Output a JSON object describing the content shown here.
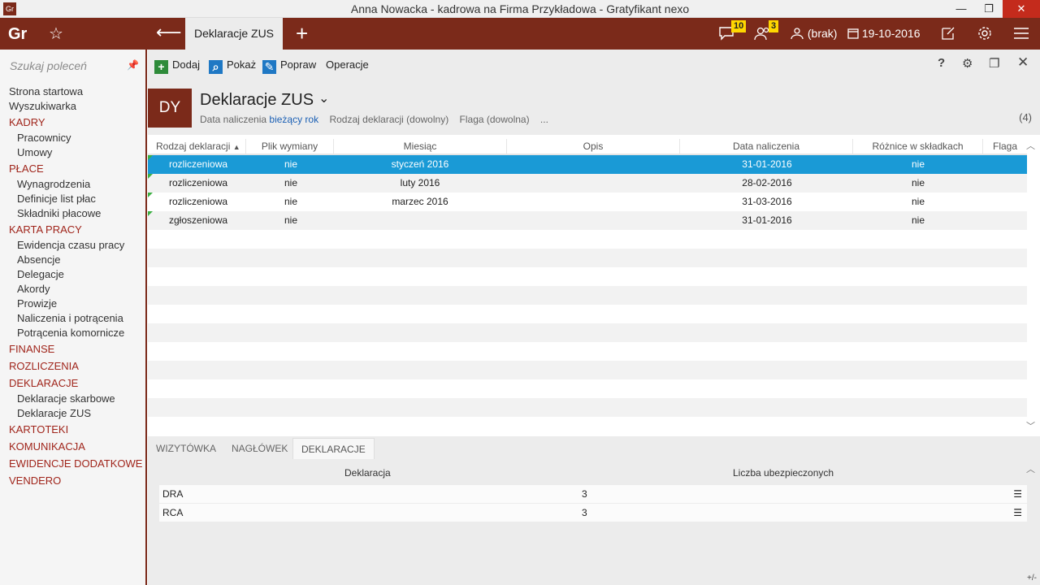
{
  "window": {
    "title": "Anna Nowacka - kadrowa na Firma Przykładowa - Gratyfikant nexo",
    "app_icon": "Gr",
    "minimize": "—",
    "restore": "❐",
    "close": "✕"
  },
  "topbar": {
    "logo": "Gr",
    "active_tab": "Deklaracje ZUS",
    "messages_badge": "10",
    "tasks_badge": "3",
    "user_label": "(brak)",
    "date": "19-10-2016"
  },
  "sidebar": {
    "search_placeholder": "Szukaj poleceń",
    "items": [
      {
        "label": "Strona startowa",
        "kind": "item"
      },
      {
        "label": "Wyszukiwarka",
        "kind": "item"
      },
      {
        "label": "KADRY",
        "kind": "cat"
      },
      {
        "label": "Pracownicy",
        "kind": "sub"
      },
      {
        "label": "Umowy",
        "kind": "sub"
      },
      {
        "label": "PŁACE",
        "kind": "cat"
      },
      {
        "label": "Wynagrodzenia",
        "kind": "sub"
      },
      {
        "label": "Definicje list płac",
        "kind": "sub"
      },
      {
        "label": "Składniki płacowe",
        "kind": "sub"
      },
      {
        "label": "KARTA PRACY",
        "kind": "cat"
      },
      {
        "label": "Ewidencja czasu pracy",
        "kind": "sub"
      },
      {
        "label": "Absencje",
        "kind": "sub"
      },
      {
        "label": "Delegacje",
        "kind": "sub"
      },
      {
        "label": "Akordy",
        "kind": "sub"
      },
      {
        "label": "Prowizje",
        "kind": "sub"
      },
      {
        "label": "Naliczenia i potrącenia",
        "kind": "sub"
      },
      {
        "label": "Potrącenia komornicze",
        "kind": "sub"
      },
      {
        "label": "FINANSE",
        "kind": "cat"
      },
      {
        "label": "ROZLICZENIA",
        "kind": "cat"
      },
      {
        "label": "DEKLARACJE",
        "kind": "cat"
      },
      {
        "label": "Deklaracje skarbowe",
        "kind": "sub"
      },
      {
        "label": "Deklaracje ZUS",
        "kind": "sub"
      },
      {
        "label": "KARTOTEKI",
        "kind": "cat"
      },
      {
        "label": "KOMUNIKACJA",
        "kind": "cat"
      },
      {
        "label": "EWIDENCJE DODATKOWE",
        "kind": "cat"
      },
      {
        "label": "VENDERO",
        "kind": "cat"
      }
    ]
  },
  "toolbar": {
    "add_label": "Dodaj",
    "show_label": "Pokaż",
    "edit_label": "Popraw",
    "operations_label": "Operacje",
    "help_label": "?"
  },
  "header": {
    "badge": "DY",
    "title": "Deklaracje ZUS",
    "filter_date_label": "Data naliczenia",
    "filter_date_value": "bieżący rok",
    "filter_type": "Rodzaj deklaracji (dowolny)",
    "filter_flag": "Flaga (dowolna)",
    "filter_more": "...",
    "count": "(4)"
  },
  "grid": {
    "columns": [
      "Rodzaj deklaracji",
      "Plik wymiany",
      "Miesiąc",
      "Opis",
      "Data naliczenia",
      "Różnice w składkach",
      "Flaga"
    ],
    "rows": [
      {
        "rodzaj": "rozliczeniowa",
        "plik": "nie",
        "miesiac": "styczeń 2016",
        "opis": "",
        "data": "31-01-2016",
        "roznice": "nie",
        "flaga": "",
        "selected": true
      },
      {
        "rodzaj": "rozliczeniowa",
        "plik": "nie",
        "miesiac": "luty 2016",
        "opis": "",
        "data": "28-02-2016",
        "roznice": "nie",
        "flaga": ""
      },
      {
        "rodzaj": "rozliczeniowa",
        "plik": "nie",
        "miesiac": "marzec 2016",
        "opis": "",
        "data": "31-03-2016",
        "roznice": "nie",
        "flaga": ""
      },
      {
        "rodzaj": "zgłoszeniowa",
        "plik": "nie",
        "miesiac": "",
        "opis": "",
        "data": "31-01-2016",
        "roznice": "nie",
        "flaga": ""
      }
    ]
  },
  "bottom": {
    "tabs": [
      "WIZYTÓWKA",
      "NAGŁÓWEK",
      "DEKLARACJE"
    ],
    "active_tab": "DEKLARACJE",
    "col_declaration": "Deklaracja",
    "col_insured": "Liczba ubezpieczonych",
    "rows": [
      {
        "name": "DRA",
        "count": "3"
      },
      {
        "name": "RCA",
        "count": "3"
      }
    ],
    "plus_minus": "+/-"
  }
}
